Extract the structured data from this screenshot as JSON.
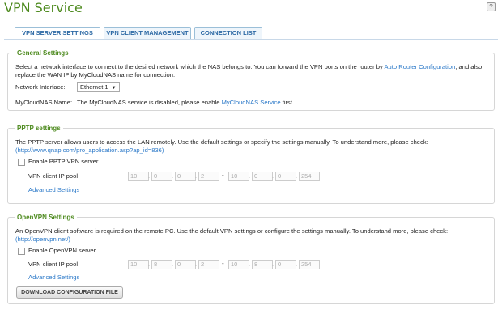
{
  "page": {
    "title": "VPN Service"
  },
  "tabs": [
    {
      "label": "VPN SERVER SETTINGS"
    },
    {
      "label": "VPN CLIENT MANAGEMENT"
    },
    {
      "label": "CONNECTION LIST"
    }
  ],
  "general": {
    "legend": "General Settings",
    "desc_line1": "Select a network interface to connect to the desired network which the NAS belongs to. You can forward the VPN ports on the router by",
    "desc_link": "Auto Router Configuration",
    "desc_line1_end": ", and also",
    "desc_line2": "replace the WAN IP by MyCloudNAS name for connection.",
    "interface_label": "Network Interface:",
    "interface_value": "Ethernet 1",
    "mycloud_label": "MyCloudNAS Name:",
    "mycloud_text": "The MyCloudNAS service is disabled, please enable",
    "mycloud_link": "MyCloudNAS Service",
    "mycloud_end": "first."
  },
  "pptp": {
    "legend": "PPTP settings",
    "desc_line1": "The PPTP server allows users to access the LAN remotely. Use the default settings or specify the settings manually. To understand more, please check:",
    "desc_link": "(http://www.qnap.com/pro_application.asp?ap_id=836)",
    "enable_label": "Enable PPTP VPN server",
    "pool_label": "VPN client IP pool",
    "ip_start": [
      "10",
      "0",
      "0",
      "2"
    ],
    "ip_end": [
      "10",
      "0",
      "0",
      "254"
    ],
    "advanced": "Advanced Settings"
  },
  "openvpn": {
    "legend": "OpenVPN Settings",
    "desc_line1": "An OpenVPN client software is required on the remote PC. Use the default VPN settings or configure the settings manually. To understand more, please check:",
    "desc_link": "(http://openvpn.net/)",
    "enable_label": "Enable OpenVPN server",
    "pool_label": "VPN client IP pool",
    "ip_start": [
      "10",
      "8",
      "0",
      "2"
    ],
    "ip_end": [
      "10",
      "8",
      "0",
      "254"
    ],
    "advanced": "Advanced Settings",
    "download_button": "DOWNLOAD CONFIGURATION FILE"
  }
}
